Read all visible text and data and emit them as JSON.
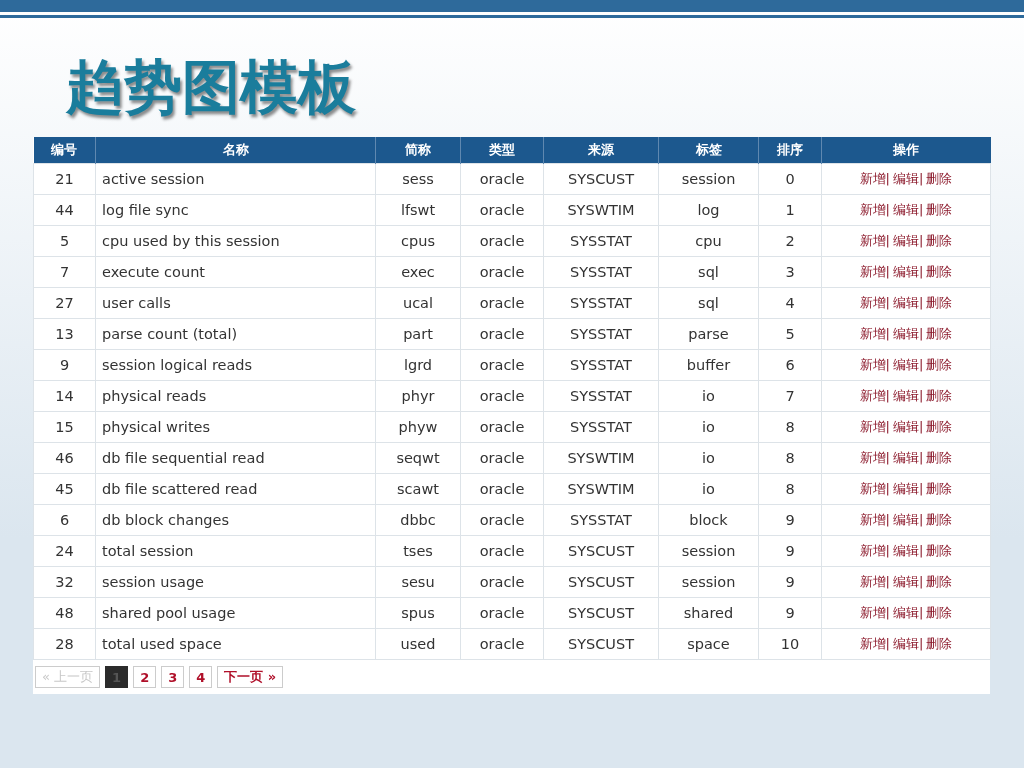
{
  "title": "趋势图模板",
  "table": {
    "columns": [
      "编号",
      "名称",
      "简称",
      "类型",
      "来源",
      "标签",
      "排序",
      "操作"
    ],
    "separator": "|",
    "rows": [
      {
        "cells": [
          "21",
          "active session",
          "sess",
          "oracle",
          "SYSCUST",
          "session",
          "0"
        ],
        "actions": [
          "新增",
          "编辑",
          "删除"
        ]
      },
      {
        "cells": [
          "44",
          "log file sync",
          "lfswt",
          "oracle",
          "SYSWTIM",
          "log",
          "1"
        ],
        "actions": [
          "新增",
          "编辑",
          "删除"
        ]
      },
      {
        "cells": [
          "5",
          "cpu used by this session",
          "cpus",
          "oracle",
          "SYSSTAT",
          "cpu",
          "2"
        ],
        "actions": [
          "新增",
          "编辑",
          "删除"
        ]
      },
      {
        "cells": [
          "7",
          "execute count",
          "exec",
          "oracle",
          "SYSSTAT",
          "sql",
          "3"
        ],
        "actions": [
          "新增",
          "编辑",
          "删除"
        ]
      },
      {
        "cells": [
          "27",
          "user calls",
          "ucal",
          "oracle",
          "SYSSTAT",
          "sql",
          "4"
        ],
        "actions": [
          "新增",
          "编辑",
          "删除"
        ]
      },
      {
        "cells": [
          "13",
          "parse count (total)",
          "part",
          "oracle",
          "SYSSTAT",
          "parse",
          "5"
        ],
        "actions": [
          "新增",
          "编辑",
          "删除"
        ]
      },
      {
        "cells": [
          "9",
          "session logical reads",
          "lgrd",
          "oracle",
          "SYSSTAT",
          "buffer",
          "6"
        ],
        "actions": [
          "新增",
          "编辑",
          "删除"
        ]
      },
      {
        "cells": [
          "14",
          "physical reads",
          "phyr",
          "oracle",
          "SYSSTAT",
          "io",
          "7"
        ],
        "actions": [
          "新增",
          "编辑",
          "删除"
        ]
      },
      {
        "cells": [
          "15",
          "physical writes",
          "phyw",
          "oracle",
          "SYSSTAT",
          "io",
          "8"
        ],
        "actions": [
          "新增",
          "编辑",
          "删除"
        ]
      },
      {
        "cells": [
          "46",
          "db file sequential read",
          "seqwt",
          "oracle",
          "SYSWTIM",
          "io",
          "8"
        ],
        "actions": [
          "新增",
          "编辑",
          "删除"
        ]
      },
      {
        "cells": [
          "45",
          "db file scattered read",
          "scawt",
          "oracle",
          "SYSWTIM",
          "io",
          "8"
        ],
        "actions": [
          "新增",
          "编辑",
          "删除"
        ]
      },
      {
        "cells": [
          "6",
          "db block changes",
          "dbbc",
          "oracle",
          "SYSSTAT",
          "block",
          "9"
        ],
        "actions": [
          "新增",
          "编辑",
          "删除"
        ]
      },
      {
        "cells": [
          "24",
          "total session",
          "tses",
          "oracle",
          "SYSCUST",
          "session",
          "9"
        ],
        "actions": [
          "新增",
          "编辑",
          "删除"
        ]
      },
      {
        "cells": [
          "32",
          "session usage",
          "sesu",
          "oracle",
          "SYSCUST",
          "session",
          "9"
        ],
        "actions": [
          "新增",
          "编辑",
          "删除"
        ]
      },
      {
        "cells": [
          "48",
          "shared pool usage",
          "spus",
          "oracle",
          "SYSCUST",
          "shared",
          "9"
        ],
        "actions": [
          "新增",
          "编辑",
          "删除"
        ]
      },
      {
        "cells": [
          "28",
          "total used space",
          "used",
          "oracle",
          "SYSCUST",
          "space",
          "10"
        ],
        "actions": [
          "新增",
          "编辑",
          "删除"
        ]
      }
    ]
  },
  "pagination": {
    "prev": {
      "label": "« 上一页",
      "disabled": true
    },
    "pages": [
      {
        "label": "1",
        "selected": true
      },
      {
        "label": "2",
        "selected": false
      },
      {
        "label": "3",
        "selected": false
      },
      {
        "label": "4",
        "selected": false
      }
    ],
    "next": {
      "label": "下一页 »",
      "disabled": false
    }
  }
}
